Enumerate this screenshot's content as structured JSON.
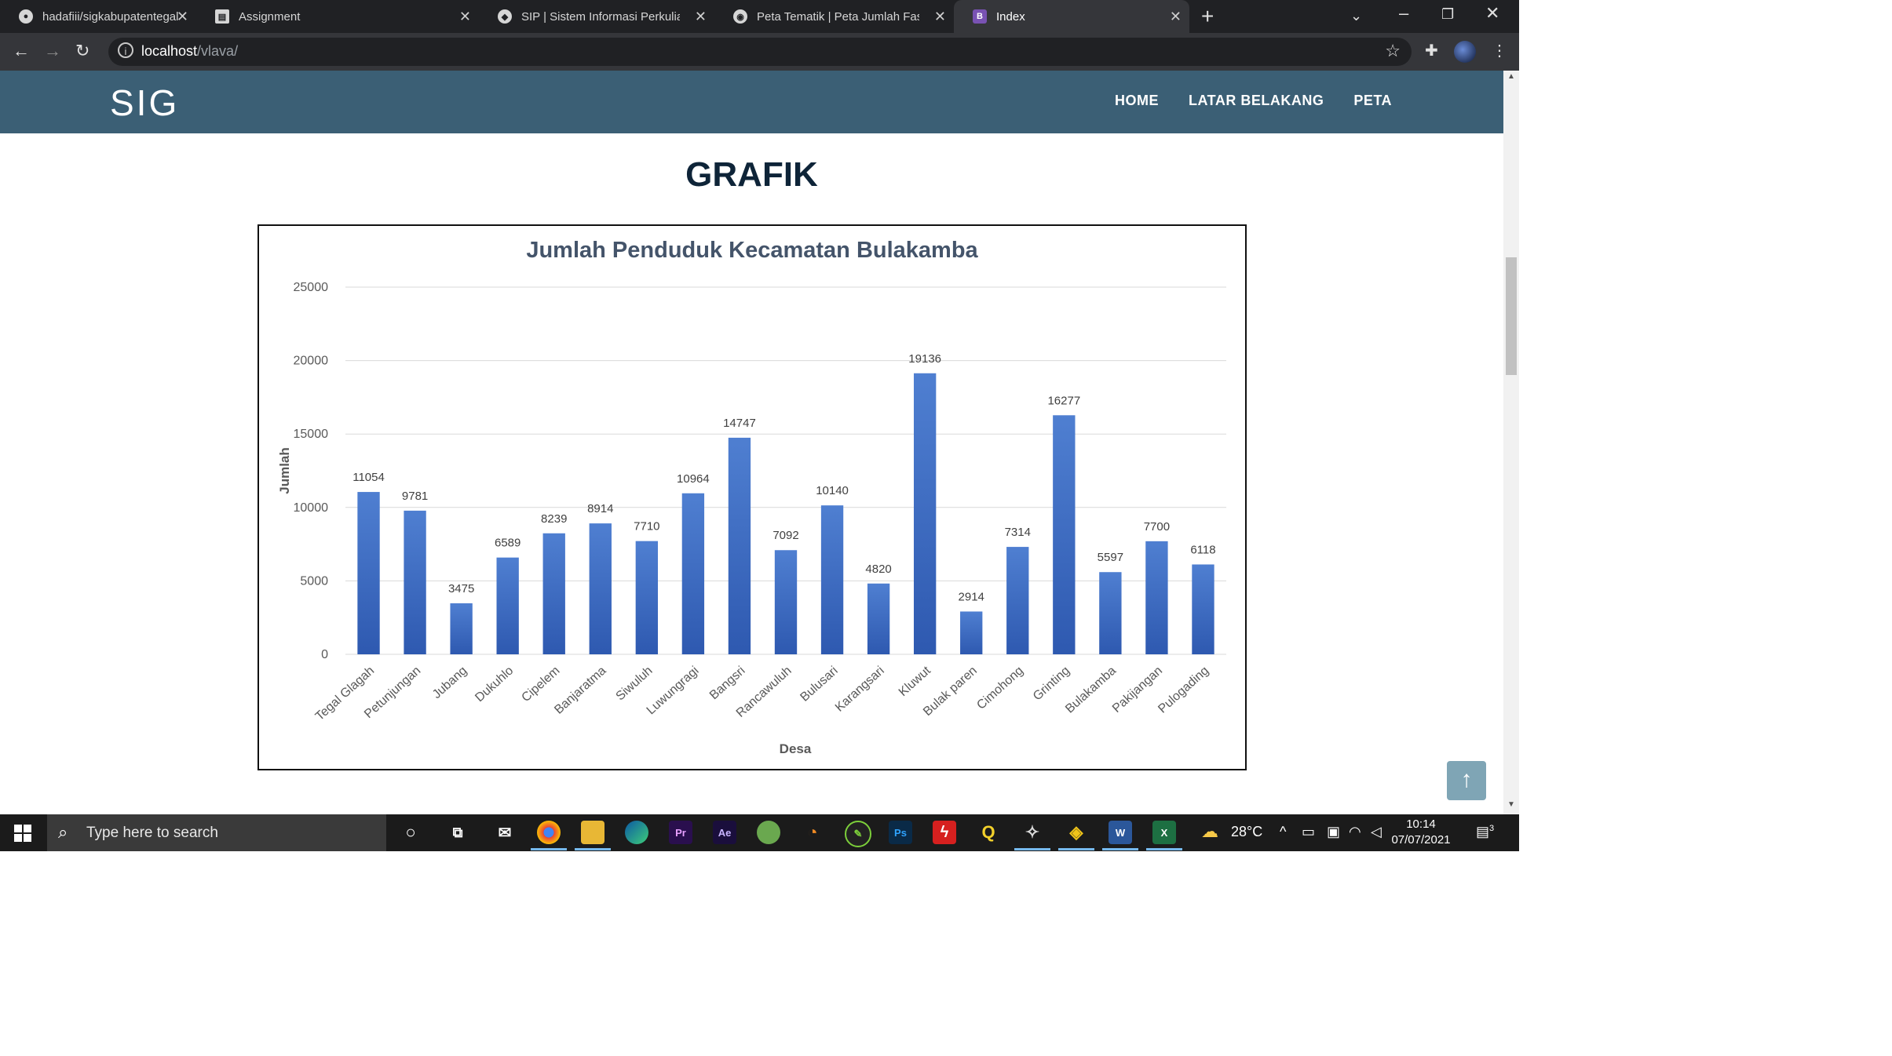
{
  "browser": {
    "tabs": [
      {
        "title": "hadafiii/sigkabupatentegal",
        "icon": "github-icon"
      },
      {
        "title": "Assignment",
        "icon": "document-icon"
      },
      {
        "title": "SIP | Sistem Informasi Perkuliahan",
        "icon": "shield-icon"
      },
      {
        "title": "Peta Tematik | Peta Jumlah Fasilitas",
        "icon": "globe-icon"
      },
      {
        "title": "Index",
        "icon": "bootstrap-icon",
        "active": true
      }
    ],
    "address": {
      "host": "localhost",
      "path": "/vlava/"
    }
  },
  "site": {
    "brand": "SIG",
    "nav": [
      "HOME",
      "LATAR BELAKANG",
      "PETA"
    ],
    "heading": "GRAFIK"
  },
  "chart_data": {
    "type": "bar",
    "title": "Jumlah Penduduk Kecamatan Bulakamba",
    "xlabel": "Desa",
    "ylabel": "Jumlah",
    "ylim": [
      0,
      25000
    ],
    "yticks": [
      0,
      5000,
      10000,
      15000,
      20000,
      25000
    ],
    "grid": true,
    "color": "#4472c4",
    "categories": [
      "Tegal Glagah",
      "Petunjungan",
      "Jubang",
      "Dukuhlo",
      "Cipelem",
      "Banjaratma",
      "Siwuluh",
      "Luwungragi",
      "Bangsri",
      "Rancawuluh",
      "Bulusari",
      "Karangsari",
      "Kluwut",
      "Bulak paren",
      "Cimohong",
      "Grinting",
      "Bulakamba",
      "Pakijangan",
      "Pulogading"
    ],
    "values": [
      11054,
      9781,
      3475,
      6589,
      8239,
      8914,
      7710,
      10964,
      14747,
      7092,
      10140,
      4820,
      19136,
      2914,
      7314,
      16277,
      5597,
      7700,
      6118
    ]
  },
  "taskbar": {
    "search_placeholder": "Type here to search",
    "weather": "28°C",
    "time": "10:14",
    "date": "07/07/2021",
    "notifications": "3"
  }
}
